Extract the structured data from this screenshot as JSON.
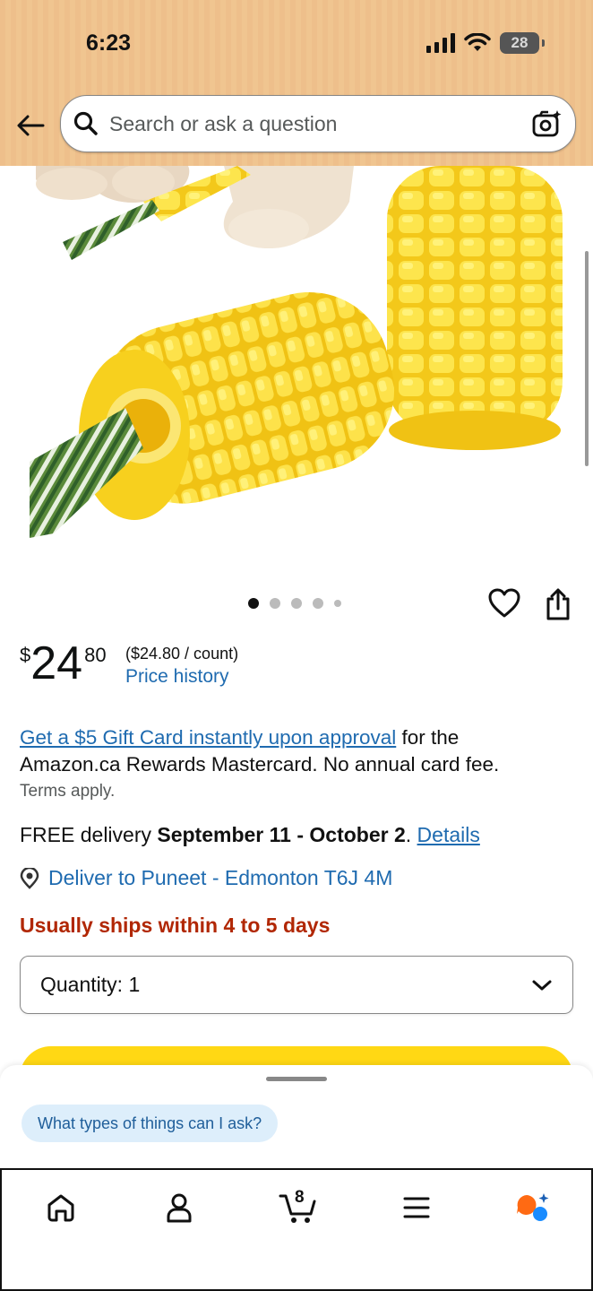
{
  "status_bar": {
    "time": "6:23",
    "battery": "28"
  },
  "search": {
    "placeholder": "Search or ask a question"
  },
  "image_carousel": {
    "active_index": 1,
    "total": 5
  },
  "price": {
    "symbol": "$",
    "whole": "24",
    "fraction": "80",
    "unit_price": "($24.80 / count)",
    "history_link": "Price history"
  },
  "promo": {
    "link": "Get a $5 Gift Card instantly upon approval",
    "text": " for the Amazon.ca Rewards Mastercard. No annual card fee.",
    "terms": "Terms apply."
  },
  "delivery": {
    "prefix": "FREE delivery ",
    "dates": "September 11 - October 2",
    "separator": ". ",
    "details_link": "Details"
  },
  "deliver_to": "Deliver to Puneet - Edmonton T6J 4M",
  "shipping_notice": "Usually ships within 4 to 5 days",
  "quantity": {
    "label": "Quantity:",
    "value": "1"
  },
  "assistant": {
    "suggestion": "What types of things can I ask?"
  },
  "nav": {
    "cart_count": "8"
  },
  "colors": {
    "header_bg": "#eebf8b",
    "link": "#1F6BB0",
    "alert_red": "#B12704",
    "add_to_cart": "#FFD814",
    "chip_bg": "#DDEEFB",
    "rufus_orange": "#FF6A13",
    "rufus_blue": "#1A8CFF"
  }
}
